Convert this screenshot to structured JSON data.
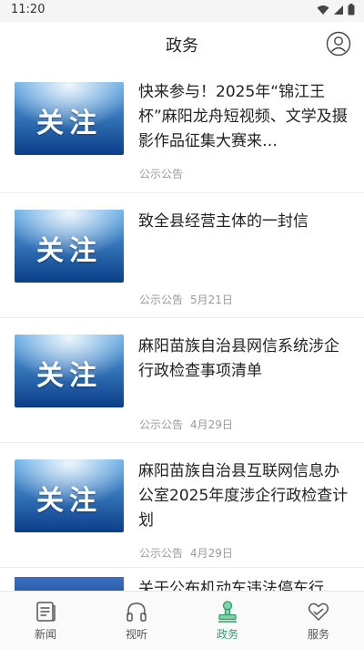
{
  "status": {
    "time": "11:20"
  },
  "header": {
    "title": "政务"
  },
  "thumb_label": "关注",
  "news": [
    {
      "title": "快来参与！2025年“锦江王杯”麻阳龙舟短视频、文学及摄影作品征集大赛来…",
      "category": "公示公告",
      "date": ""
    },
    {
      "title": "致全县经营主体的一封信",
      "category": "公示公告",
      "date": "5月21日"
    },
    {
      "title": "麻阳苗族自治县网信系统涉企行政检查事项清单",
      "category": "公示公告",
      "date": "4月29日"
    },
    {
      "title": "麻阳苗族自治县互联网信息办公室2025年度涉企行政检查计划",
      "category": "公示公告",
      "date": "4月29日"
    },
    {
      "title": "关于公布机动车违法停车行"
    }
  ],
  "nav": {
    "items": [
      {
        "label": "新闻",
        "icon": "news-icon"
      },
      {
        "label": "视听",
        "icon": "headphones-icon"
      },
      {
        "label": "政务",
        "icon": "government-icon",
        "active": true
      },
      {
        "label": "服务",
        "icon": "heart-hands-icon"
      }
    ]
  },
  "colors": {
    "accent": "#2e9e6a",
    "thumb_top": "#4a9de0",
    "thumb_bottom": "#0a3f8c"
  }
}
